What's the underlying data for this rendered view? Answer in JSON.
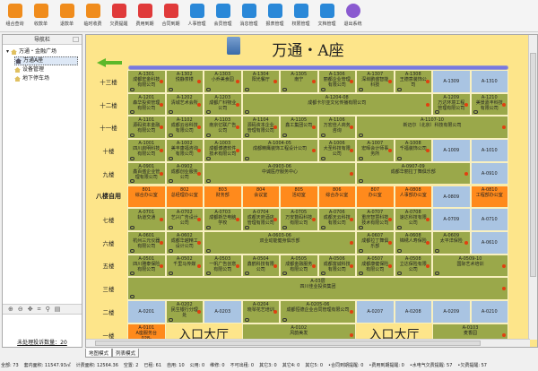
{
  "toolbar": [
    {
      "label": "组合查询",
      "icon": "map-pin-icon",
      "color": "#f08c1c"
    },
    {
      "label": "收款单",
      "icon": "money-in-icon",
      "color": "#f08c1c"
    },
    {
      "label": "退款单",
      "icon": "money-out-icon",
      "color": "#f08c1c"
    },
    {
      "label": "临时收费",
      "icon": "coin-icon",
      "color": "#f08c1c"
    },
    {
      "label": "欠费提醒",
      "icon": "bell-icon",
      "color": "#e03a3a"
    },
    {
      "label": "费用到期",
      "icon": "calendar-icon",
      "color": "#e03a3a"
    },
    {
      "label": "合同到期",
      "icon": "contract-icon",
      "color": "#e03a3a"
    },
    {
      "label": "人事管理",
      "icon": "staff-doc-icon",
      "color": "#2a88d8"
    },
    {
      "label": "会员管理",
      "icon": "member-icon",
      "color": "#2a88d8"
    },
    {
      "label": "消息管理",
      "icon": "message-icon",
      "color": "#2a88d8"
    },
    {
      "label": "报表管理",
      "icon": "report-icon",
      "color": "#2a88d8"
    },
    {
      "label": "权限管理",
      "icon": "gear-icon",
      "color": "#2a88d8"
    },
    {
      "label": "文档管理",
      "icon": "document-icon",
      "color": "#2a88d8"
    },
    {
      "label": "退出系统",
      "icon": "power-icon",
      "color": "#8a5ad0"
    }
  ],
  "sidebar": {
    "title": "导航栏",
    "tree": [
      "万通・金融广场",
      "万通A座",
      "设备管理",
      "地下停车场"
    ],
    "complaints": "未处理投诉数量：20"
  },
  "main": {
    "title": "万通・A座"
  },
  "colors": {
    "rented": "#9aa84a",
    "vacant": "#a9c4e2",
    "self": "#ff8a1c",
    "hall": "#fde58a"
  },
  "floors": [
    {
      "label": "十三楼",
      "cells": [
        [
          "A-1301",
          "成都宏金科技有限公司",
          "rented",
          1
        ],
        [
          "A-1302",
          "悦静茶楼",
          "rented",
          1
        ],
        [
          "A-1303",
          "小乔美食园",
          "rented",
          1
        ],
        [
          "A-1304",
          "阳光餐厅",
          "rented",
          1
        ],
        [
          "A-1305",
          "南宁",
          "rented",
          1
        ],
        [
          "A-1306",
          "丽都企业管理有限公司",
          "rented",
          1
        ],
        [
          "A-1307",
          "深圳鹏盛智能科技",
          "rented",
          1
        ],
        [
          "A-1308",
          "王德意装饰公司",
          "rented",
          1
        ],
        [
          "A-1309",
          "",
          "vacant",
          1
        ],
        [
          "A-1310",
          "",
          "vacant",
          1
        ]
      ]
    },
    {
      "label": "十二楼",
      "cells": [
        [
          "A-1201",
          "森华投资管理有限公司",
          "rented",
          1
        ],
        [
          "A-1202",
          "清城艺术会所",
          "rented",
          1
        ],
        [
          "A-1203",
          "成都广科物业公司",
          "rented",
          1
        ],
        [
          "A-1204-08",
          "成都卡尔亚文化传播有限公司",
          "rented",
          5
        ],
        [
          "A-1209",
          "万达环境工程管理有限公司",
          "rented",
          1
        ],
        [
          "A-1210",
          "美景嘉丰科技有限公司",
          "rented",
          1
        ]
      ]
    },
    {
      "label": "十一楼",
      "cells": [
        [
          "A-1101",
          "源码资本金融有限公司",
          "rented",
          1
        ],
        [
          "A-1102",
          "成都云谷科技有限公司",
          "rented",
          1
        ],
        [
          "A-1103",
          "南京亿联广告公司",
          "rented",
          1
        ],
        [
          "A-1104",
          "源码资本企业管理有限公司",
          "rented",
          1
        ],
        [
          "A-1105",
          "鑫工集团公司",
          "rented",
          1
        ],
        [
          "A-1106",
          "万宏佳人商务咨询",
          "rented",
          1
        ],
        [
          "A-1107-10",
          "新迈尔（北京）科技有限公司",
          "rented",
          4
        ]
      ]
    },
    {
      "label": "十楼",
      "cells": [
        [
          "A-1001",
          "四川启明科技有限公司",
          "rented",
          1
        ],
        [
          "A-1002",
          "美丰康福咨询有限公司",
          "rented",
          1
        ],
        [
          "A-1003",
          "成都博德软件技术有限公司",
          "rented",
          1
        ],
        [
          "A-1004-05",
          "成都精鹰装饰工程设计公司",
          "rented",
          2
        ],
        [
          "A-1006",
          "大圣科技有限公司",
          "rented",
          1
        ],
        [
          "A-1007",
          "宏晖会计师事务所",
          "rented",
          1
        ],
        [
          "A-1008",
          "千福装饰公司",
          "rented",
          1
        ],
        [
          "A-1009",
          "",
          "vacant",
          1
        ],
        [
          "A-1010",
          "",
          "vacant",
          1
        ]
      ]
    },
    {
      "label": "九楼",
      "cells": [
        [
          "A-0901",
          "鑫百盛企业管理有限公司",
          "rented",
          1
        ],
        [
          "A-0902",
          "成都创业服务公司",
          "rented",
          1
        ],
        [
          "A-0903-06",
          "中诚医疗服务中心",
          "rented",
          4
        ],
        [
          "A-0907-09",
          "成都华丽拉丁舞俱乐部",
          "rented",
          3
        ],
        [
          "A-0910",
          "",
          "vacant",
          1
        ]
      ]
    },
    {
      "label": "八楼自用",
      "bold": true,
      "cells": [
        [
          "801",
          "综合办公室",
          "self",
          1
        ],
        [
          "802",
          "总经理办公室",
          "self",
          1
        ],
        [
          "803",
          "财务部",
          "self",
          1
        ],
        [
          "804",
          "会议室",
          "self",
          1
        ],
        [
          "805",
          "活动室",
          "self",
          1
        ],
        [
          "806",
          "综合办公室",
          "self",
          1
        ],
        [
          "807",
          "办公室",
          "self",
          1
        ],
        [
          "A-0808",
          "人事部办公室",
          "self",
          1
        ],
        [
          "A-0809",
          "",
          "vacant",
          1
        ],
        [
          "A-0810",
          "工程部办公室",
          "self",
          1
        ]
      ]
    },
    {
      "label": "七楼",
      "cells": [
        [
          "A-0701",
          "轨道交通",
          "rented",
          1
        ],
        [
          "A-0702",
          "艺兴广告设计公司",
          "rented",
          1
        ],
        [
          "A-0703",
          "成都新华电脑学校",
          "rented",
          1
        ],
        [
          "A-0704",
          "成都天府酒店管理有限公司",
          "rented",
          1
        ],
        [
          "A-0705",
          "万安数码科技有限公司",
          "rented",
          1
        ],
        [
          "A-0706",
          "成都天云科技有限公司",
          "rented",
          1
        ],
        [
          "A-0707",
          "重庆智慧科技技术有限公司",
          "rented",
          1
        ],
        [
          "A-0708",
          "速达科技有限公司",
          "rented",
          1
        ],
        [
          "A-0709",
          "",
          "vacant",
          1
        ],
        [
          "A-0710",
          "",
          "vacant",
          1
        ]
      ]
    },
    {
      "label": "六楼",
      "cells": [
        [
          "A-0601",
          "杭州三元仪器有限公司",
          "rented",
          1
        ],
        [
          "A-0602",
          "成都华越精工设计公司",
          "rented",
          1
        ],
        [
          "A-0603-06",
          "双业动能健身俱乐部",
          "rented",
          4
        ],
        [
          "A-0607",
          "成都拉丁舞俱乐部",
          "rented",
          1
        ],
        [
          "A-0608",
          "锦绣人寿保险",
          "rented",
          1
        ],
        [
          "A-0609",
          "太平洋保险",
          "rented",
          1
        ],
        [
          "A-0610",
          "",
          "vacant",
          1
        ]
      ]
    },
    {
      "label": "五楼",
      "cells": [
        [
          "A-0501",
          "四川雅泰保险有限公司",
          "rented",
          1
        ],
        [
          "A-0502",
          "千里马传媒",
          "rented",
          1
        ],
        [
          "A-0503",
          "一帆广告创意有限公司",
          "rented",
          1
        ],
        [
          "A-0504",
          "鑫鹤科技有限公司",
          "rented",
          1
        ],
        [
          "A-0505",
          "成都金融服务有限公司",
          "rented",
          1
        ],
        [
          "A-0506",
          "成都富诚科技有限公司",
          "rented",
          1
        ],
        [
          "A-0507",
          "成都康健保险有限公司",
          "rented",
          1
        ],
        [
          "A-0508",
          "立达保险有限公司",
          "rented",
          1
        ],
        [
          "A-0509-10",
          "国际艺术培训",
          "rented",
          2
        ]
      ]
    },
    {
      "label": "三楼",
      "cells": [
        [
          "A-03层",
          "四川佳业投资集团",
          "rented",
          10
        ]
      ]
    },
    {
      "label": "二楼",
      "cells": [
        [
          "A-0201",
          "",
          "vacant",
          1
        ],
        [
          "A-0202",
          "民生银行分理处",
          "rented",
          1
        ],
        [
          "A-0203",
          "",
          "vacant",
          1
        ],
        [
          "A-0204",
          "晓琴花艺培训",
          "rented",
          1
        ],
        [
          "A-0205-06",
          "成都恒德企业合同管理有限公司",
          "rented",
          2
        ],
        [
          "A-0207",
          "",
          "vacant",
          1
        ],
        [
          "A-0208",
          "",
          "vacant",
          1
        ],
        [
          "A-0209",
          "",
          "vacant",
          1
        ],
        [
          "A-0210",
          "",
          "vacant",
          1
        ]
      ]
    },
    {
      "label": "一楼",
      "cells": [
        [
          "A-0101",
          "A座服务台 028-88888888",
          "self",
          1
        ],
        [
          "",
          "入口大厅",
          "hall",
          2
        ],
        [
          "A-0102",
          "风韵美发",
          "rented",
          3
        ],
        [
          "",
          "入口大厅",
          "hall",
          2
        ],
        [
          "A-0103",
          "麦香园",
          "rented",
          2
        ]
      ]
    }
  ],
  "tabs": [
    "地图模式",
    "列表模式"
  ],
  "status": [
    "全部: 73",
    "套内面积: 11547.93㎡",
    "计费面积: 12564.36",
    "空置: 2",
    "已租: 61",
    "自用: 10",
    "公用: 0",
    "维修: 0",
    "不可出租: 0",
    "其它3: 0",
    "其它4: 0",
    "其它5: 0",
    "•合同到期提醒: 0",
    "•费用到期提醒: 0",
    "•水电气欠费提醒: 57",
    "•欠费提醒: 57"
  ]
}
